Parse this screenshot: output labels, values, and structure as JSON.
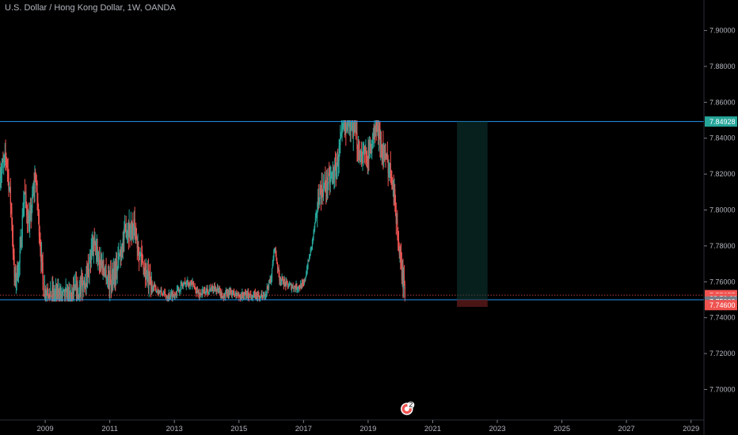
{
  "header": {
    "title": "U.S. Dollar / Hong Kong Dollar, 1W, OANDA"
  },
  "chart_data": {
    "type": "candlestick",
    "title": "U.S. Dollar / Hong Kong Dollar, 1W, OANDA",
    "xlabel": "",
    "ylabel": "",
    "x_ticks": [
      "2009",
      "2011",
      "2013",
      "2015",
      "2017",
      "2019",
      "2021",
      "2023",
      "2025",
      "2027",
      "2029"
    ],
    "y_ticks": [
      "7.70000",
      "7.72000",
      "7.74000",
      "7.76000",
      "7.78000",
      "7.80000",
      "7.82000",
      "7.84000",
      "7.86000",
      "7.88000",
      "7.90000"
    ],
    "y_tick_values": [
      7.7,
      7.72,
      7.74,
      7.76,
      7.78,
      7.8,
      7.82,
      7.84,
      7.86,
      7.88,
      7.9
    ],
    "x_range": [
      2007.6,
      2029.4
    ],
    "y_range": [
      7.683,
      7.917
    ],
    "grid": false,
    "colors": {
      "up": "#26a69a",
      "down": "#ef5350",
      "line": "#2196f3",
      "background": "#000000"
    },
    "trend": [
      [
        2007.6,
        7.82
      ],
      [
        2007.8,
        7.83
      ],
      [
        2007.95,
        7.8
      ],
      [
        2008.05,
        7.76
      ],
      [
        2008.2,
        7.77
      ],
      [
        2008.35,
        7.81
      ],
      [
        2008.5,
        7.79
      ],
      [
        2008.7,
        7.82
      ],
      [
        2008.85,
        7.78
      ],
      [
        2008.95,
        7.756
      ],
      [
        2009.1,
        7.753
      ],
      [
        2009.4,
        7.751
      ],
      [
        2009.7,
        7.752
      ],
      [
        2010.0,
        7.754
      ],
      [
        2010.2,
        7.76
      ],
      [
        2010.5,
        7.78
      ],
      [
        2010.75,
        7.77
      ],
      [
        2011.0,
        7.76
      ],
      [
        2011.25,
        7.77
      ],
      [
        2011.5,
        7.79
      ],
      [
        2011.75,
        7.79
      ],
      [
        2012.0,
        7.77
      ],
      [
        2012.25,
        7.758
      ],
      [
        2012.5,
        7.755
      ],
      [
        2012.75,
        7.752
      ],
      [
        2013.0,
        7.753
      ],
      [
        2013.25,
        7.758
      ],
      [
        2013.5,
        7.76
      ],
      [
        2013.75,
        7.753
      ],
      [
        2014.0,
        7.755
      ],
      [
        2014.25,
        7.757
      ],
      [
        2014.5,
        7.752
      ],
      [
        2014.75,
        7.754
      ],
      [
        2015.0,
        7.752
      ],
      [
        2015.25,
        7.753
      ],
      [
        2015.5,
        7.752
      ],
      [
        2015.75,
        7.751
      ],
      [
        2016.0,
        7.762
      ],
      [
        2016.1,
        7.78
      ],
      [
        2016.25,
        7.762
      ],
      [
        2016.5,
        7.758
      ],
      [
        2016.75,
        7.757
      ],
      [
        2017.0,
        7.758
      ],
      [
        2017.25,
        7.78
      ],
      [
        2017.5,
        7.81
      ],
      [
        2017.75,
        7.815
      ],
      [
        2018.0,
        7.822
      ],
      [
        2018.25,
        7.848
      ],
      [
        2018.5,
        7.847
      ],
      [
        2018.75,
        7.832
      ],
      [
        2019.0,
        7.83
      ],
      [
        2019.25,
        7.847
      ],
      [
        2019.5,
        7.83
      ],
      [
        2019.75,
        7.82
      ],
      [
        2019.9,
        7.79
      ],
      [
        2020.0,
        7.77
      ],
      [
        2020.1,
        7.758
      ],
      [
        2020.15,
        7.7526
      ]
    ],
    "horizontal_lines": [
      7.84928,
      7.75
    ],
    "dotted_line": 7.75257,
    "position_box": {
      "x_start": 2021.75,
      "x_end": 2022.7,
      "top": 7.84928,
      "mid": 7.75,
      "bottom": 7.746
    },
    "price_tags": [
      {
        "label": "7.84928",
        "value": 7.84928,
        "bg": "#26a69a"
      },
      {
        "label": "7.75257",
        "value": 7.75257,
        "bg": "#ef5350"
      },
      {
        "label": "22:56:01",
        "value": 7.7508,
        "bg": "#ef5350"
      },
      {
        "label": "7.75000",
        "value": 7.749,
        "bg": "#787b86"
      },
      {
        "label": "7.74600",
        "value": 7.747,
        "bg": "#ef5350"
      }
    ],
    "event_marker": {
      "x": 2020.2,
      "label": "2"
    }
  }
}
